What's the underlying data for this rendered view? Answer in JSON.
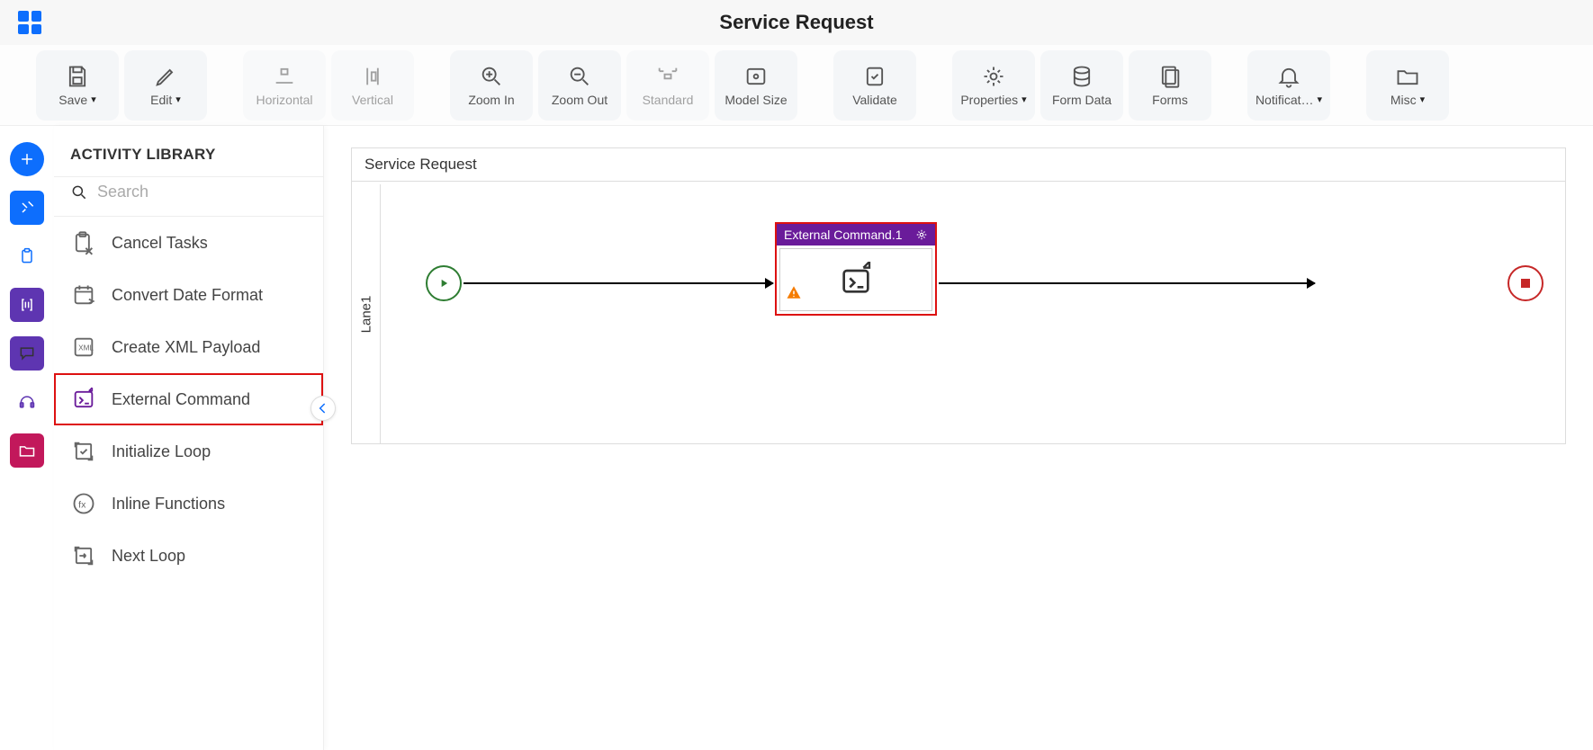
{
  "header": {
    "title": "Service Request"
  },
  "toolbar": {
    "save": "Save",
    "edit": "Edit",
    "horizontal": "Horizontal",
    "vertical": "Vertical",
    "zoom_in": "Zoom In",
    "zoom_out": "Zoom Out",
    "standard": "Standard",
    "model_size": "Model Size",
    "validate": "Validate",
    "properties": "Properties",
    "form_data": "Form Data",
    "forms": "Forms",
    "notifications": "Notificat…",
    "misc": "Misc"
  },
  "sidebar": {
    "heading": "ACTIVITY LIBRARY",
    "search_placeholder": "Search",
    "items": [
      {
        "label": "Cancel Tasks"
      },
      {
        "label": "Convert Date Format"
      },
      {
        "label": "Create XML Payload"
      },
      {
        "label": "External Command"
      },
      {
        "label": "Initialize Loop"
      },
      {
        "label": "Inline Functions"
      },
      {
        "label": "Next Loop"
      }
    ]
  },
  "canvas": {
    "title": "Service Request",
    "lane_label": "Lane1",
    "node_title": "External Command.1"
  }
}
